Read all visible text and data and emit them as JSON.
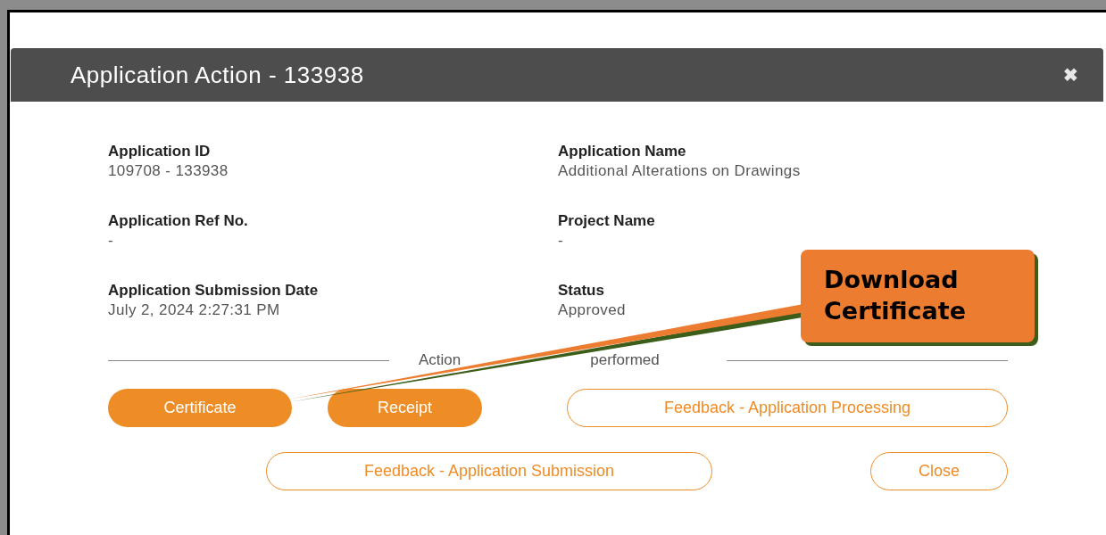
{
  "dialog": {
    "title": "Application Action - 133938",
    "close_symbol": "✖",
    "fields": [
      {
        "label": "Application ID",
        "value": "109708 - 133938"
      },
      {
        "label": "Application Name",
        "value": "Additional Alterations on Drawings"
      },
      {
        "label": "Application Ref No.",
        "value": "-"
      },
      {
        "label": "Project Name",
        "value": "-"
      },
      {
        "label": "Application Submission Date",
        "value": "July 2, 2024 2:27:31 PM"
      },
      {
        "label": "Status",
        "value": "Approved"
      }
    ],
    "section_heading_parts": [
      "Action",
      "performed"
    ],
    "button_rows": [
      [
        {
          "label": "Certificate",
          "kind": "filled"
        },
        {
          "label": "Receipt",
          "kind": "filled"
        },
        {
          "label": "Feedback - Application Processing",
          "kind": "outline"
        }
      ],
      [
        {
          "label": "Feedback - Application Submission",
          "kind": "outline"
        },
        {
          "label": "Close",
          "kind": "outline"
        }
      ]
    ]
  },
  "callout": {
    "text": "Download Certificate"
  }
}
